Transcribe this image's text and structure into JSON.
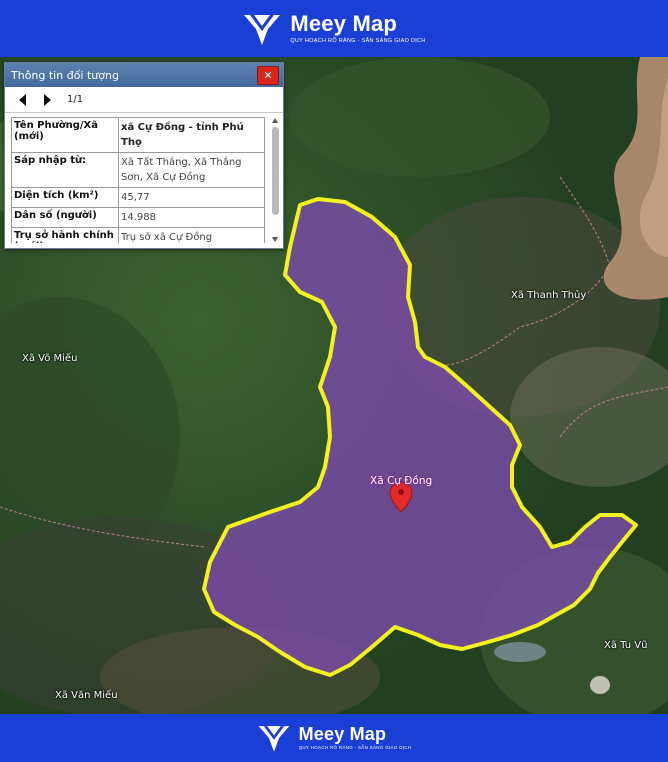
{
  "brand": {
    "name": "Meey Map",
    "tagline": "QUY HOẠCH RÕ RÀNG - SẴN SÀNG GIAO DỊCH",
    "color": "#1a3fd6"
  },
  "panel": {
    "title": "Thông tin đối tượng",
    "close_icon": "close-icon",
    "pager_text": "1/1",
    "rows": [
      {
        "label": "Tên Phường/Xã (mới)",
        "value": "xã Cự Đồng - tỉnh Phú Thọ"
      },
      {
        "label": "Sáp nhập từ:",
        "value": "Xã Tất Thắng, Xã Thắng Sơn, Xã Cự Đồng"
      },
      {
        "label": "Diện tích (km²)",
        "value": "45,77"
      },
      {
        "label": "Dân số (người)",
        "value": "14.988"
      },
      {
        "label": "Trụ sở hành chính (mới)",
        "value": "Trụ sở xã Cự Đồng"
      }
    ]
  },
  "map": {
    "boundary_color": "#f4f21e",
    "fill_color": "#7b4aa8",
    "labels": {
      "center": "Xã Cự Đồng",
      "thanh_thuy": "Xã Thanh Thủy",
      "vo_mieu": "Xã Võ Miếu",
      "tu_vu": "Xã Tu Vũ",
      "van_mieu": "Xã Văn Miếu"
    }
  }
}
